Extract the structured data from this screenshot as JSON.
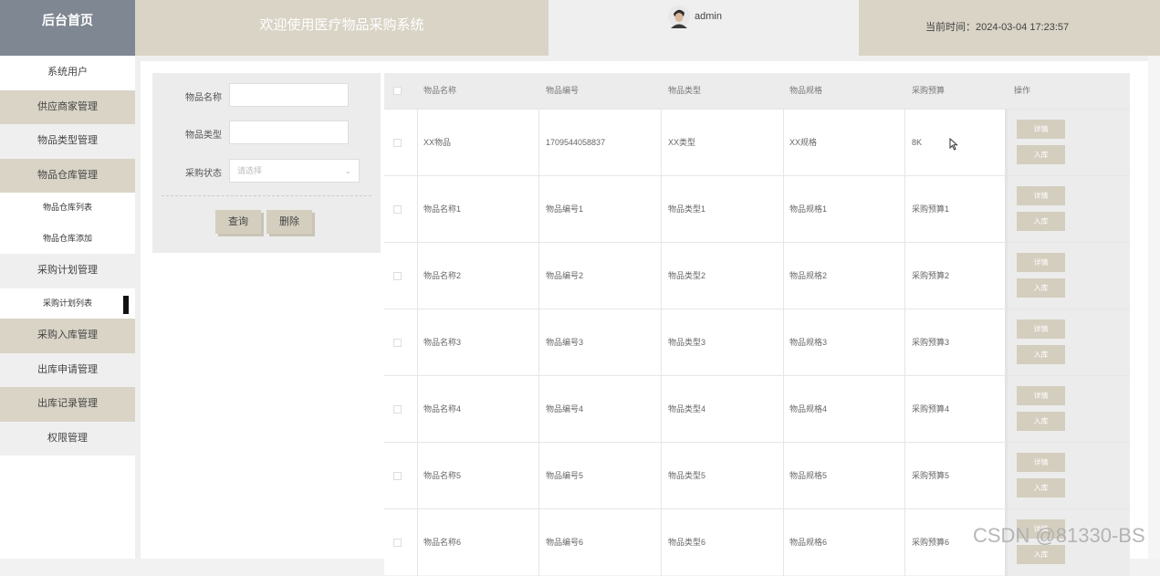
{
  "header": {
    "brand": "后台首页",
    "welcome": "欢迎使用医疗物品采购系统",
    "username": "admin",
    "time": "当前时间：2024-03-04 17:23:57"
  },
  "sidebar": [
    {
      "label": "系统用户",
      "type": "nav"
    },
    {
      "label": "供应商家管理",
      "type": "nav"
    },
    {
      "label": "物品类型管理",
      "type": "nav"
    },
    {
      "label": "物品仓库管理",
      "type": "nav"
    },
    {
      "label": "物品仓库列表",
      "type": "sub"
    },
    {
      "label": "物品仓库添加",
      "type": "sub"
    },
    {
      "label": "采购计划管理",
      "type": "nav"
    },
    {
      "label": "采购计划列表",
      "type": "sub"
    },
    {
      "label": "采购入库管理",
      "type": "nav"
    },
    {
      "label": "出库申请管理",
      "type": "nav"
    },
    {
      "label": "出库记录管理",
      "type": "nav"
    },
    {
      "label": "权限管理",
      "type": "nav"
    }
  ],
  "search": {
    "name_label": "物品名称",
    "type_label": "物品类型",
    "status_label": "采购状态",
    "status_placeholder": "请选择",
    "query_button": "查询",
    "delete_button": "删除"
  },
  "table": {
    "headers": [
      "物品名称",
      "物品编号",
      "物品类型",
      "物品规格",
      "采购预算",
      "操作"
    ],
    "detail_label": "详情",
    "stock_label": "入库",
    "rows": [
      [
        "XX物品",
        "1709544058837",
        "XX类型",
        "XX规格",
        "8K"
      ],
      [
        "物品名称1",
        "物品编号1",
        "物品类型1",
        "物品规格1",
        "采购预算1"
      ],
      [
        "物品名称2",
        "物品编号2",
        "物品类型2",
        "物品规格2",
        "采购预算2"
      ],
      [
        "物品名称3",
        "物品编号3",
        "物品类型3",
        "物品规格3",
        "采购预算3"
      ],
      [
        "物品名称4",
        "物品编号4",
        "物品类型4",
        "物品规格4",
        "采购预算4"
      ],
      [
        "物品名称5",
        "物品编号5",
        "物品类型5",
        "物品规格5",
        "采购预算5"
      ],
      [
        "物品名称6",
        "物品编号6",
        "物品类型6",
        "物品规格6",
        "采购预算6"
      ]
    ]
  },
  "watermark": "CSDN @81330-BS"
}
